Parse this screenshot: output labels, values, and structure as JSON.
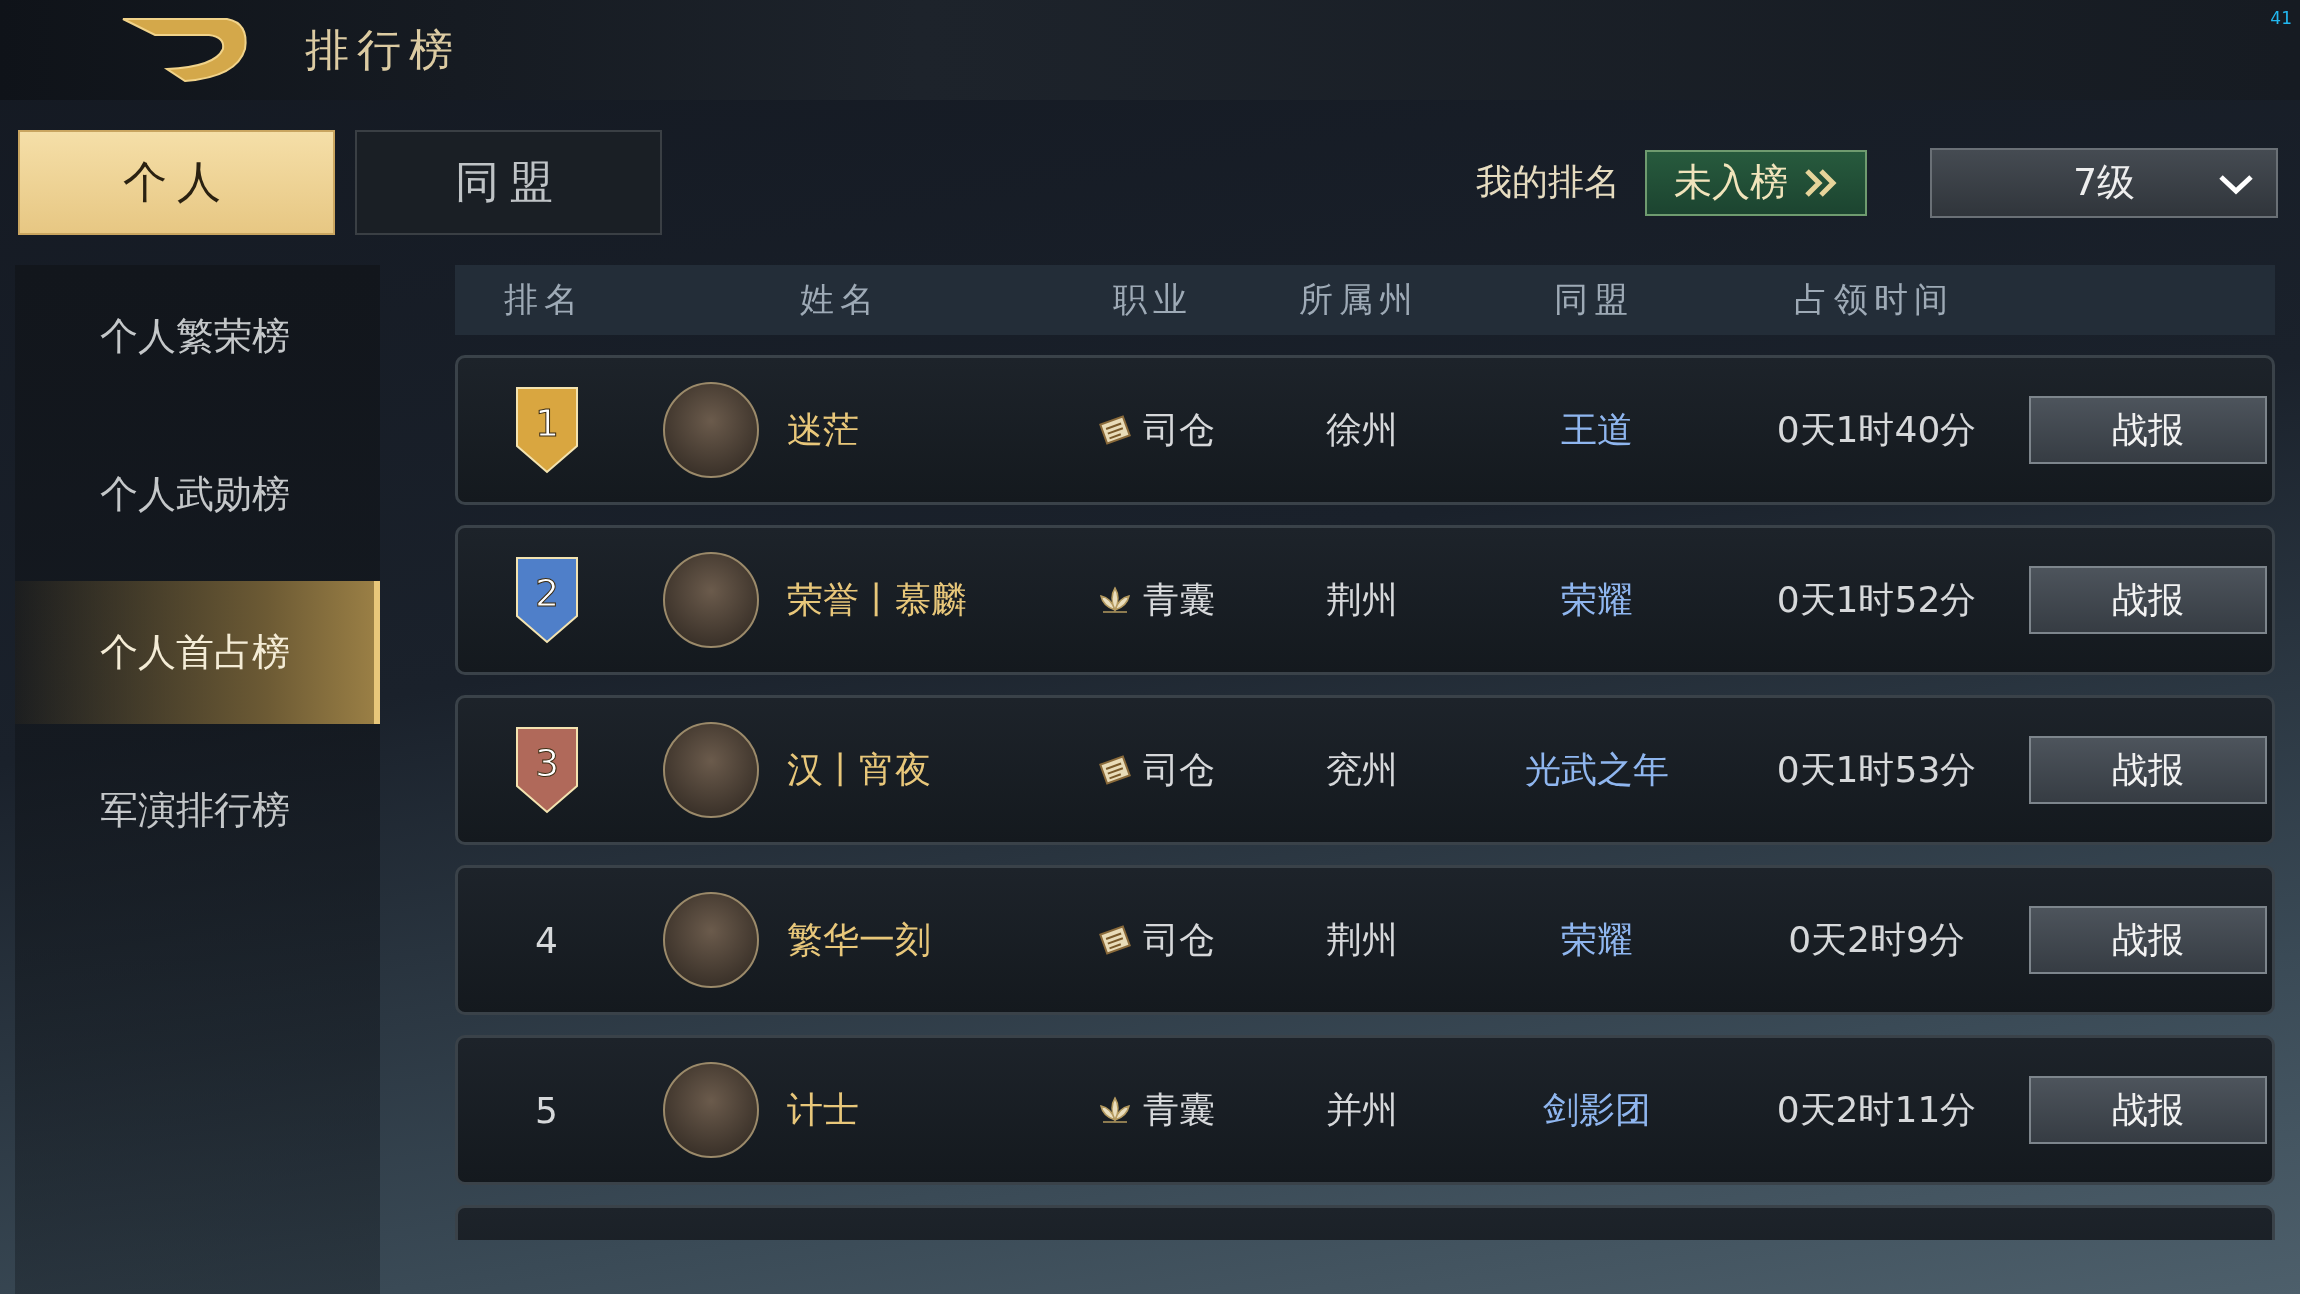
{
  "header": {
    "title": "排行榜"
  },
  "overlay_number": "41",
  "tabs": [
    {
      "label": "个人",
      "selected": true
    },
    {
      "label": "同盟",
      "selected": false
    }
  ],
  "my_rank": {
    "label": "我的排名",
    "value": "未入榜"
  },
  "level_dropdown": {
    "value": "7级"
  },
  "sidebar": {
    "items": [
      {
        "label": "个人繁荣榜",
        "selected": false
      },
      {
        "label": "个人武勋榜",
        "selected": false
      },
      {
        "label": "个人首占榜",
        "selected": true
      },
      {
        "label": "军演排行榜",
        "selected": false
      }
    ]
  },
  "table": {
    "columns": [
      "排名",
      "姓名",
      "职业",
      "所属州",
      "同盟",
      "占领时间"
    ],
    "rows": [
      {
        "rank": {
          "kind": "medal",
          "text": "1",
          "color": "#d9a640"
        },
        "name": "迷茫",
        "job": {
          "kind": "scroll",
          "text": "司仓"
        },
        "state": "徐州",
        "alliance": "王道",
        "time": "0天1时40分",
        "action": "战报"
      },
      {
        "rank": {
          "kind": "medal",
          "text": "2",
          "color": "#4f7fc9"
        },
        "name": "荣誉丨慕麟",
        "job": {
          "kind": "lotus",
          "text": "青囊"
        },
        "state": "荆州",
        "alliance": "荣耀",
        "time": "0天1时52分",
        "action": "战报"
      },
      {
        "rank": {
          "kind": "medal",
          "text": "3",
          "color": "#b0695a"
        },
        "name": "汉丨宵夜",
        "job": {
          "kind": "scroll",
          "text": "司仓"
        },
        "state": "兖州",
        "alliance": "光武之年",
        "time": "0天1时53分",
        "action": "战报"
      },
      {
        "rank": {
          "kind": "plain",
          "text": "4"
        },
        "name": "繁华一刻",
        "job": {
          "kind": "scroll",
          "text": "司仓"
        },
        "state": "荆州",
        "alliance": "荣耀",
        "time": "0天2时9分",
        "action": "战报"
      },
      {
        "rank": {
          "kind": "plain",
          "text": "5"
        },
        "name": "计士",
        "job": {
          "kind": "lotus",
          "text": "青囊"
        },
        "state": "并州",
        "alliance": "剑影团",
        "time": "0天2时11分",
        "action": "战报"
      }
    ]
  }
}
